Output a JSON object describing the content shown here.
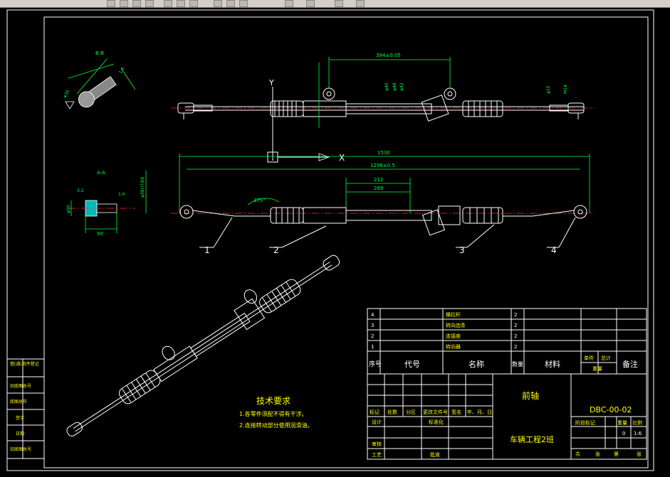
{
  "toolbar": {
    "label": "CAD toolbar"
  },
  "views": {
    "section_bb": {
      "title": "B-B",
      "dim_dia": "φ30",
      "dim_a": "φ35",
      "dim_b": "1.6"
    },
    "section_aa": {
      "title": "A-A",
      "dim_len": "90",
      "dim_dia": "φ50",
      "dim_h": "3.2",
      "dim_r": "1.6",
      "dim_side": "φ38H7/k6"
    },
    "top_view": {
      "dim_top": "394±0.05",
      "dim_side1": "φ40",
      "dim_side2": "φ48",
      "dim_mid": "φ42",
      "dim_right": "M14",
      "dim_r2": "φ15",
      "axis_y": "Y",
      "axis_x": "X"
    },
    "front_view": {
      "dim_total": "1530",
      "dim_span": "1296±0.5",
      "dim_212": "212",
      "dim_269": "269",
      "angle": "375°",
      "callouts": [
        "1",
        "2",
        "3",
        "4"
      ]
    }
  },
  "tech_req": {
    "title": "技术要求",
    "items": [
      "1.各零件须配不得有干涉。",
      "2.连接转动部分使用润滑油。"
    ]
  },
  "parts_list": {
    "rows": [
      {
        "no": "4",
        "name": "横拉杆",
        "qty": "2"
      },
      {
        "no": "3",
        "name": "转向齿条",
        "qty": "2"
      },
      {
        "no": "2",
        "name": "连接座",
        "qty": "2"
      },
      {
        "no": "1",
        "name": "转向器",
        "qty": "2"
      }
    ],
    "header": {
      "no": "序号",
      "code": "代号",
      "name": "名称",
      "qty": "数量",
      "material": "材料",
      "unit_w": "单件",
      "total_w": "总计",
      "weight": "重量",
      "remark": "备注"
    }
  },
  "title_block": {
    "part_name": "前轴",
    "drawing_no": "DBC-00-02",
    "school": "车辆工程2班",
    "revision_header": [
      "标记",
      "处数",
      "分区",
      "更改文件号",
      "签名",
      "年、月、日"
    ],
    "roles": [
      "设计",
      "标准化",
      "审核",
      "工艺",
      "批准"
    ],
    "stage_label": "阶段标记",
    "weight_label": "重量",
    "scale_label": "比例",
    "weight_value": "0",
    "scale_value": "1:6",
    "sheets": [
      "共",
      "张",
      "第",
      "张"
    ]
  },
  "left_strip": [
    "借(通)用件登记",
    "旧底图总号",
    "底图总号",
    "签字",
    "日期",
    "旧底图总号"
  ]
}
